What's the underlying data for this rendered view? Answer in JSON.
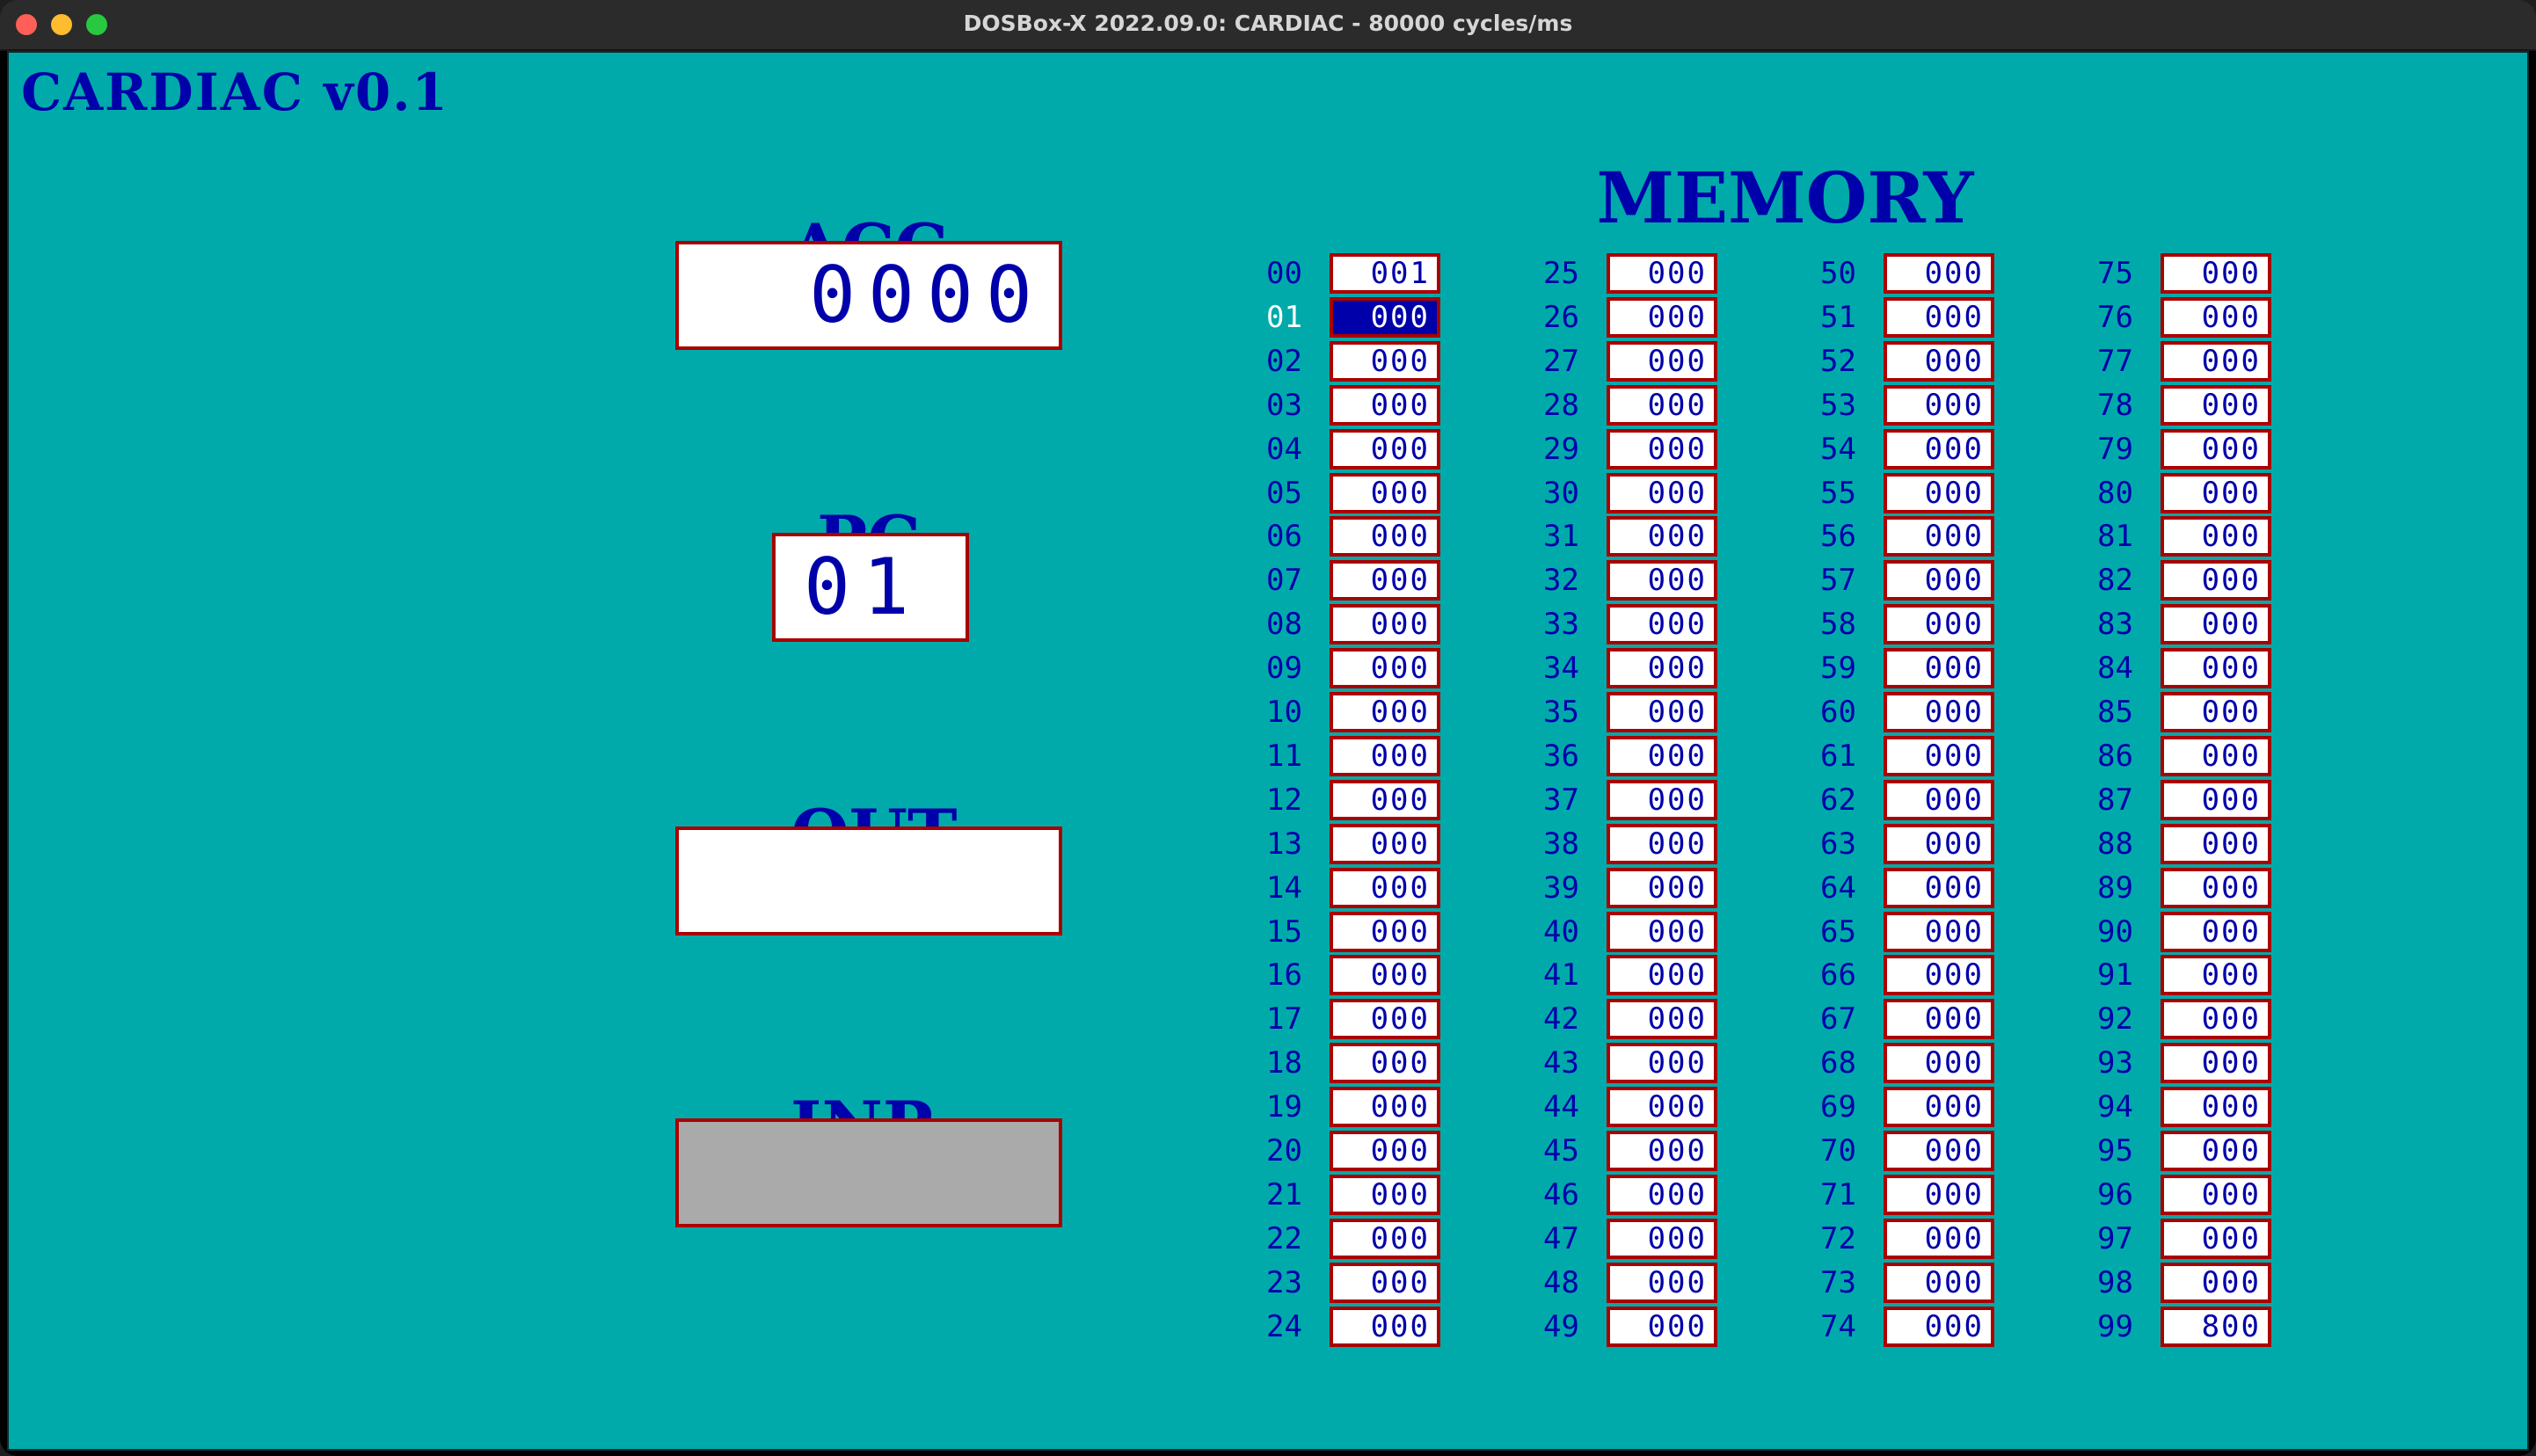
{
  "window": {
    "title": "DOSBox-X 2022.09.0: CARDIAC - 80000 cycles/ms"
  },
  "app": {
    "title": "CARDIAC  v0.1"
  },
  "registers": {
    "acc": {
      "label": "ACC",
      "value": "0000"
    },
    "pc": {
      "label": "PC",
      "value": "01"
    },
    "out": {
      "label": "OUT",
      "value": ""
    },
    "inp": {
      "label": "INP",
      "value": ""
    }
  },
  "memory": {
    "label": "MEMORY",
    "selected_address": "01",
    "cells": [
      {
        "addr": "00",
        "value": "001"
      },
      {
        "addr": "01",
        "value": "000"
      },
      {
        "addr": "02",
        "value": "000"
      },
      {
        "addr": "03",
        "value": "000"
      },
      {
        "addr": "04",
        "value": "000"
      },
      {
        "addr": "05",
        "value": "000"
      },
      {
        "addr": "06",
        "value": "000"
      },
      {
        "addr": "07",
        "value": "000"
      },
      {
        "addr": "08",
        "value": "000"
      },
      {
        "addr": "09",
        "value": "000"
      },
      {
        "addr": "10",
        "value": "000"
      },
      {
        "addr": "11",
        "value": "000"
      },
      {
        "addr": "12",
        "value": "000"
      },
      {
        "addr": "13",
        "value": "000"
      },
      {
        "addr": "14",
        "value": "000"
      },
      {
        "addr": "15",
        "value": "000"
      },
      {
        "addr": "16",
        "value": "000"
      },
      {
        "addr": "17",
        "value": "000"
      },
      {
        "addr": "18",
        "value": "000"
      },
      {
        "addr": "19",
        "value": "000"
      },
      {
        "addr": "20",
        "value": "000"
      },
      {
        "addr": "21",
        "value": "000"
      },
      {
        "addr": "22",
        "value": "000"
      },
      {
        "addr": "23",
        "value": "000"
      },
      {
        "addr": "24",
        "value": "000"
      },
      {
        "addr": "25",
        "value": "000"
      },
      {
        "addr": "26",
        "value": "000"
      },
      {
        "addr": "27",
        "value": "000"
      },
      {
        "addr": "28",
        "value": "000"
      },
      {
        "addr": "29",
        "value": "000"
      },
      {
        "addr": "30",
        "value": "000"
      },
      {
        "addr": "31",
        "value": "000"
      },
      {
        "addr": "32",
        "value": "000"
      },
      {
        "addr": "33",
        "value": "000"
      },
      {
        "addr": "34",
        "value": "000"
      },
      {
        "addr": "35",
        "value": "000"
      },
      {
        "addr": "36",
        "value": "000"
      },
      {
        "addr": "37",
        "value": "000"
      },
      {
        "addr": "38",
        "value": "000"
      },
      {
        "addr": "39",
        "value": "000"
      },
      {
        "addr": "40",
        "value": "000"
      },
      {
        "addr": "41",
        "value": "000"
      },
      {
        "addr": "42",
        "value": "000"
      },
      {
        "addr": "43",
        "value": "000"
      },
      {
        "addr": "44",
        "value": "000"
      },
      {
        "addr": "45",
        "value": "000"
      },
      {
        "addr": "46",
        "value": "000"
      },
      {
        "addr": "47",
        "value": "000"
      },
      {
        "addr": "48",
        "value": "000"
      },
      {
        "addr": "49",
        "value": "000"
      },
      {
        "addr": "50",
        "value": "000"
      },
      {
        "addr": "51",
        "value": "000"
      },
      {
        "addr": "52",
        "value": "000"
      },
      {
        "addr": "53",
        "value": "000"
      },
      {
        "addr": "54",
        "value": "000"
      },
      {
        "addr": "55",
        "value": "000"
      },
      {
        "addr": "56",
        "value": "000"
      },
      {
        "addr": "57",
        "value": "000"
      },
      {
        "addr": "58",
        "value": "000"
      },
      {
        "addr": "59",
        "value": "000"
      },
      {
        "addr": "60",
        "value": "000"
      },
      {
        "addr": "61",
        "value": "000"
      },
      {
        "addr": "62",
        "value": "000"
      },
      {
        "addr": "63",
        "value": "000"
      },
      {
        "addr": "64",
        "value": "000"
      },
      {
        "addr": "65",
        "value": "000"
      },
      {
        "addr": "66",
        "value": "000"
      },
      {
        "addr": "67",
        "value": "000"
      },
      {
        "addr": "68",
        "value": "000"
      },
      {
        "addr": "69",
        "value": "000"
      },
      {
        "addr": "70",
        "value": "000"
      },
      {
        "addr": "71",
        "value": "000"
      },
      {
        "addr": "72",
        "value": "000"
      },
      {
        "addr": "73",
        "value": "000"
      },
      {
        "addr": "74",
        "value": "000"
      },
      {
        "addr": "75",
        "value": "000"
      },
      {
        "addr": "76",
        "value": "000"
      },
      {
        "addr": "77",
        "value": "000"
      },
      {
        "addr": "78",
        "value": "000"
      },
      {
        "addr": "79",
        "value": "000"
      },
      {
        "addr": "80",
        "value": "000"
      },
      {
        "addr": "81",
        "value": "000"
      },
      {
        "addr": "82",
        "value": "000"
      },
      {
        "addr": "83",
        "value": "000"
      },
      {
        "addr": "84",
        "value": "000"
      },
      {
        "addr": "85",
        "value": "000"
      },
      {
        "addr": "86",
        "value": "000"
      },
      {
        "addr": "87",
        "value": "000"
      },
      {
        "addr": "88",
        "value": "000"
      },
      {
        "addr": "89",
        "value": "000"
      },
      {
        "addr": "90",
        "value": "000"
      },
      {
        "addr": "91",
        "value": "000"
      },
      {
        "addr": "92",
        "value": "000"
      },
      {
        "addr": "93",
        "value": "000"
      },
      {
        "addr": "94",
        "value": "000"
      },
      {
        "addr": "95",
        "value": "000"
      },
      {
        "addr": "96",
        "value": "000"
      },
      {
        "addr": "97",
        "value": "000"
      },
      {
        "addr": "98",
        "value": "000"
      },
      {
        "addr": "99",
        "value": "800"
      }
    ]
  },
  "colors": {
    "background": "#00aaaa",
    "text": "#0000aa",
    "border": "#aa0000",
    "field": "#ffffff",
    "input_field": "#aaaaaa",
    "selection": "#0000aa"
  }
}
